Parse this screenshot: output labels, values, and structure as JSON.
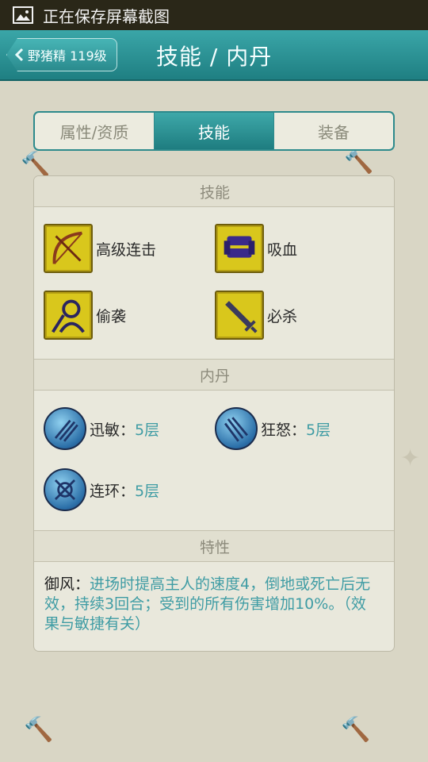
{
  "status_bar": {
    "text": "正在保存屏幕截图",
    "icon": "image-icon"
  },
  "header": {
    "back_label": "野猪精 119级",
    "title": "技能 / 内丹"
  },
  "tabs": [
    {
      "label": "属性/资质",
      "active": false
    },
    {
      "label": "技能",
      "active": true
    },
    {
      "label": "装备",
      "active": false
    }
  ],
  "sections": {
    "skills": {
      "title": "技能",
      "items": [
        {
          "name": "高级连击",
          "icon": "bow-icon"
        },
        {
          "name": "吸血",
          "icon": "blood-icon"
        },
        {
          "name": "偷袭",
          "icon": "sneak-attack-icon"
        },
        {
          "name": "必杀",
          "icon": "sword-icon"
        }
      ]
    },
    "neidan": {
      "title": "内丹",
      "items": [
        {
          "name": "迅敏：",
          "level": "5层",
          "icon": "agility-orb-icon"
        },
        {
          "name": "狂怒：",
          "level": "5层",
          "icon": "rage-orb-icon"
        },
        {
          "name": "连环：",
          "level": "5层",
          "icon": "chain-orb-icon"
        }
      ]
    },
    "traits": {
      "title": "特性",
      "name": "御风：",
      "description": "进场时提高主人的速度4，倒地或死亡后无效，持续3回合；受到的所有伤害增加10%。（效果与敏捷有关）"
    }
  },
  "colors": {
    "accent": "#2d8a8c",
    "status_bar": "#2a2718",
    "value_text": "#3f9ca4",
    "skill_icon": "#d9c71c"
  }
}
